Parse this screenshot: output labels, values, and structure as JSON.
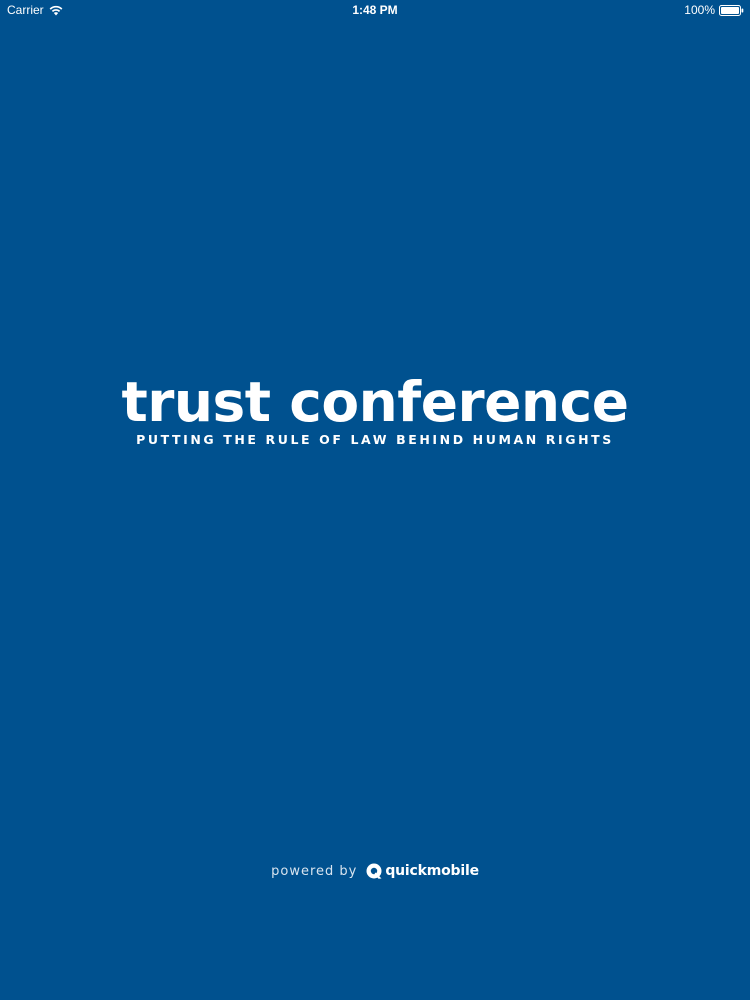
{
  "status_bar": {
    "carrier": "Carrier",
    "time": "1:48 PM",
    "battery_percent": "100%"
  },
  "splash": {
    "title": "trust conference",
    "tagline": "PUTTING THE RULE OF LAW BEHIND HUMAN RIGHTS"
  },
  "footer": {
    "powered_by": "powered by",
    "brand_name": "quickmobile"
  },
  "colors": {
    "background": "#00518f",
    "text": "#ffffff"
  },
  "icons": {
    "wifi": "wifi-icon",
    "battery": "battery-icon",
    "brand": "quickmobile-logo-icon"
  }
}
